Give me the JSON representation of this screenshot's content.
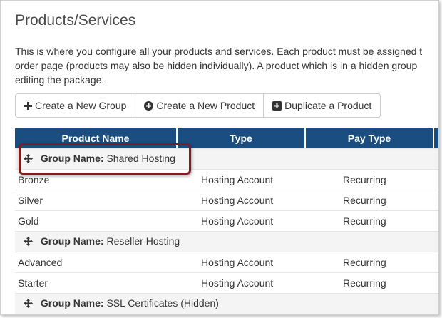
{
  "page": {
    "title": "Products/Services",
    "description_lines": [
      "This is where you configure all your products and services. Each product must be assigned t",
      "order page (products may also be hidden individually). A product which is in a hidden group",
      "editing the package."
    ]
  },
  "toolbar": {
    "create_group_label": "Create a New Group",
    "create_product_label": "Create a New Product",
    "duplicate_product_label": "Duplicate a Product"
  },
  "table": {
    "headers": [
      "Product Name",
      "Type",
      "Pay Type"
    ],
    "group_label": "Group Name:",
    "groups": [
      {
        "name": "Shared Hosting",
        "products": [
          {
            "name": "Bronze",
            "type": "Hosting Account",
            "pay_type": "Recurring"
          },
          {
            "name": "Silver",
            "type": "Hosting Account",
            "pay_type": "Recurring"
          },
          {
            "name": "Gold",
            "type": "Hosting Account",
            "pay_type": "Recurring"
          }
        ]
      },
      {
        "name": "Reseller Hosting",
        "products": [
          {
            "name": "Advanced",
            "type": "Hosting Account",
            "pay_type": "Recurring"
          },
          {
            "name": "Starter",
            "type": "Hosting Account",
            "pay_type": "Recurring"
          }
        ]
      },
      {
        "name": "SSL Certificates (Hidden)",
        "products": []
      }
    ]
  },
  "icons": {
    "create_group": "plus-icon",
    "create_product": "plus-circle-icon",
    "duplicate_product": "plus-square-icon",
    "group_drag": "move-icon"
  },
  "colors": {
    "header_bg": "#1a4d80",
    "group_row_bg": "#f4f4f4",
    "highlight_border": "#7d1d1d"
  }
}
